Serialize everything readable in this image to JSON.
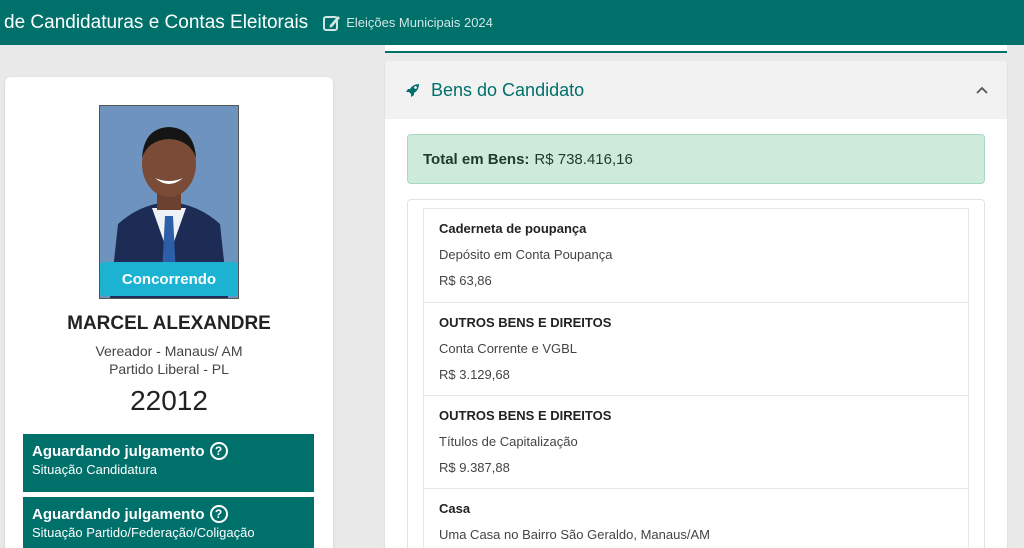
{
  "header": {
    "title": "de Candidaturas e Contas Eleitorais",
    "election": "Eleições Municipais 2024"
  },
  "candidate": {
    "status_badge": "Concorrendo",
    "name": "MARCEL ALEXANDRE",
    "role": "Vereador - Manaus/ AM",
    "party": "Partido Liberal - PL",
    "number": "22012",
    "situations": [
      {
        "title": "Aguardando julgamento",
        "subtitle": "Situação Candidatura"
      },
      {
        "title": "Aguardando julgamento",
        "subtitle": "Situação Partido/Federação/Coligação"
      }
    ]
  },
  "bens": {
    "title": "Bens do Candidato",
    "total_label": "Total em Bens:",
    "total_value": "R$ 738.416,16",
    "items": [
      {
        "type": "Caderneta de poupança",
        "description": "Depósito em Conta Poupança",
        "value": "R$ 63,86"
      },
      {
        "type": "OUTROS BENS E DIREITOS",
        "description": "Conta Corrente e VGBL",
        "value": "R$ 3.129,68"
      },
      {
        "type": "OUTROS BENS E DIREITOS",
        "description": "Títulos de Capitalização",
        "value": "R$ 9.387,88"
      },
      {
        "type": "Casa",
        "description": "Uma Casa no Bairro São Geraldo, Manaus/AM",
        "value": ""
      }
    ]
  },
  "colors": {
    "brand": "#00706b",
    "badge": "#1cb3d3",
    "total_bg": "#cdeadb"
  }
}
